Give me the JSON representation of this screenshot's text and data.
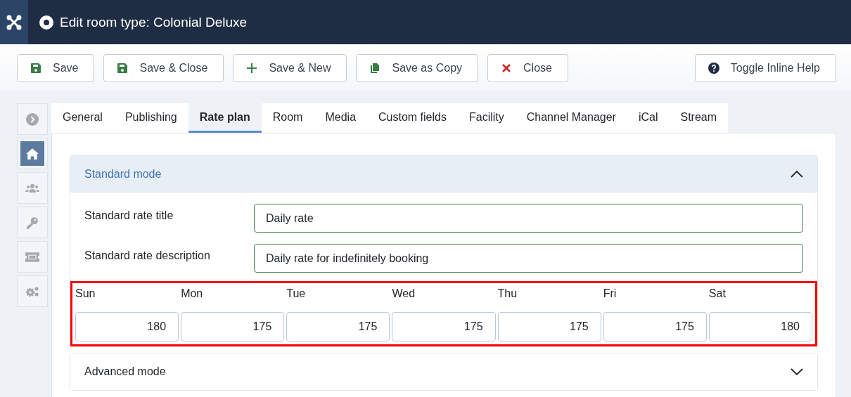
{
  "header": {
    "title": "Edit room type: Colonial Deluxe"
  },
  "toolbar": {
    "buttons": [
      {
        "label": "Save",
        "kind": "save"
      },
      {
        "label": "Save & Close",
        "kind": "save"
      },
      {
        "label": "Save & New",
        "kind": "plus"
      },
      {
        "label": "Save as Copy",
        "kind": "copy"
      },
      {
        "label": "Close",
        "kind": "close"
      }
    ],
    "help_button": {
      "label": "Toggle Inline Help"
    }
  },
  "sidebar": {
    "items": [
      {
        "kind": "chevron",
        "selected": false
      },
      {
        "kind": "home",
        "selected": true
      },
      {
        "kind": "users",
        "selected": false
      },
      {
        "kind": "key",
        "selected": false
      },
      {
        "kind": "ticket",
        "selected": false
      },
      {
        "kind": "gears",
        "selected": false
      }
    ]
  },
  "tabs": [
    {
      "label": "General",
      "selected": false
    },
    {
      "label": "Publishing",
      "selected": false
    },
    {
      "label": "Rate plan",
      "selected": true
    },
    {
      "label": "Room",
      "selected": false
    },
    {
      "label": "Media",
      "selected": false
    },
    {
      "label": "Custom fields",
      "selected": false
    },
    {
      "label": "Facility",
      "selected": false
    },
    {
      "label": "Channel Manager",
      "selected": false
    },
    {
      "label": "iCal",
      "selected": false
    },
    {
      "label": "Stream",
      "selected": false
    }
  ],
  "standard_mode": {
    "title": "Standard mode",
    "expanded": true,
    "fields": [
      {
        "label": "Standard rate title",
        "value": "Daily rate"
      },
      {
        "label": "Standard rate description",
        "value": "Daily rate for indefinitely booking"
      }
    ],
    "day_rates": [
      {
        "day": "Sun",
        "value": "180"
      },
      {
        "day": "Mon",
        "value": "175"
      },
      {
        "day": "Tue",
        "value": "175"
      },
      {
        "day": "Wed",
        "value": "175"
      },
      {
        "day": "Thu",
        "value": "175"
      },
      {
        "day": "Fri",
        "value": "175"
      },
      {
        "day": "Sat",
        "value": "180"
      }
    ]
  },
  "advanced_mode": {
    "title": "Advanced mode",
    "expanded": false
  }
}
